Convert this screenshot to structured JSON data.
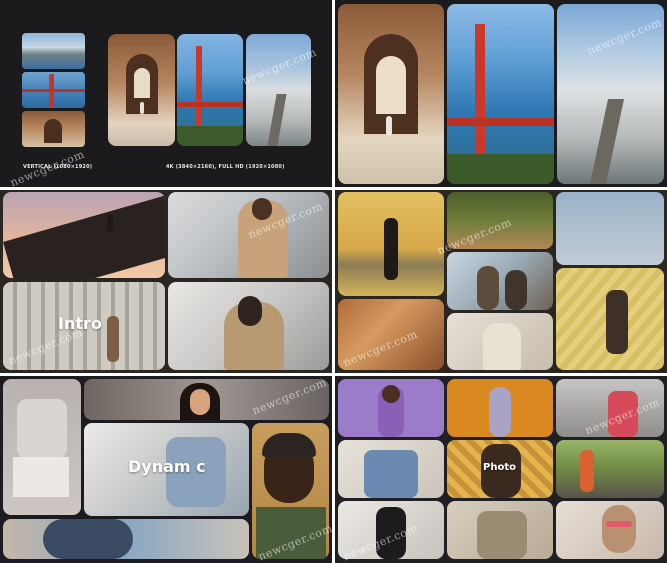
{
  "captions": {
    "vertical": "VERTICAL (1080×1920)",
    "resolution": "4K (3840×2160), FULL HD (1920×1080)"
  },
  "overlays": {
    "intro": "Intro",
    "dynamic": "Dynam c",
    "photo": "Photo"
  },
  "watermark": "newcger.com"
}
